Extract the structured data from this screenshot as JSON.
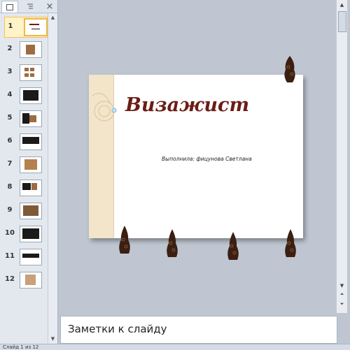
{
  "left_pane": {
    "tabs": [
      "slides-tab",
      "outline-tab"
    ],
    "close": "×",
    "thumbnails": [
      {
        "num": "1",
        "selected": true
      },
      {
        "num": "2"
      },
      {
        "num": "3"
      },
      {
        "num": "4"
      },
      {
        "num": "5"
      },
      {
        "num": "6"
      },
      {
        "num": "7"
      },
      {
        "num": "8"
      },
      {
        "num": "9"
      },
      {
        "num": "10"
      },
      {
        "num": "11"
      },
      {
        "num": "12"
      }
    ]
  },
  "slide": {
    "title": "Визажист",
    "subtitle": "Выполнила: фицунова  Светлана"
  },
  "notes": {
    "placeholder": "Заметки к слайду"
  },
  "status": {
    "text": "Слайд 1 из 12"
  }
}
